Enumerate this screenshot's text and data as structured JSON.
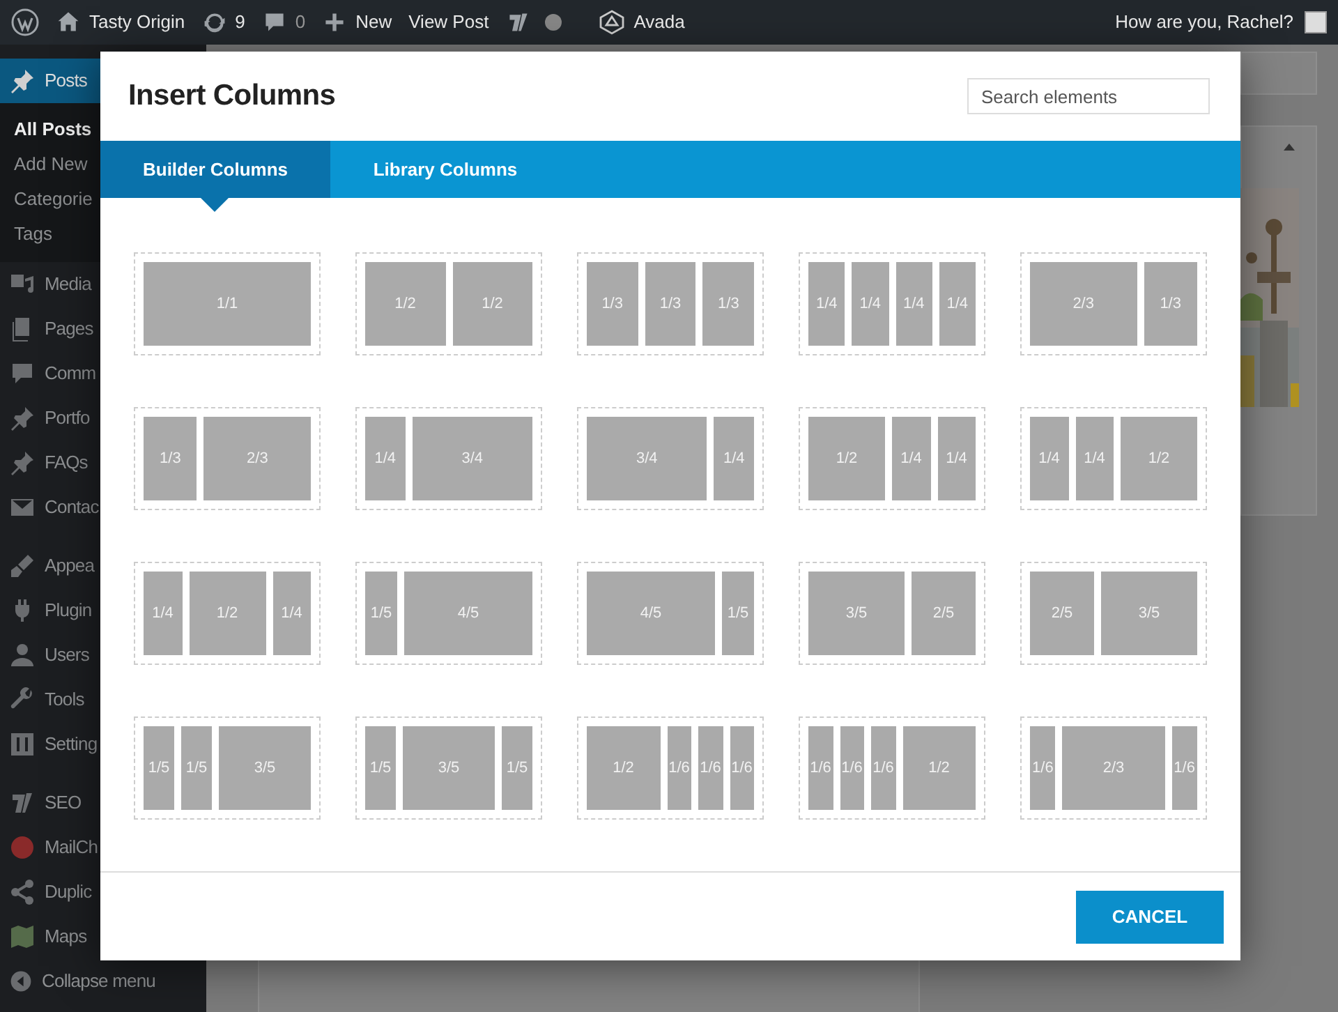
{
  "admin_bar": {
    "site": "Tasty Origin",
    "updates": "9",
    "comments": "0",
    "new": "New",
    "view": "View Post",
    "theme": "Avada",
    "greeting": "How are you, Rachel?"
  },
  "sidebar": {
    "sections": [
      [
        {
          "label": "Posts",
          "selected": true,
          "children": [
            {
              "label": "All Posts",
              "selected": true
            },
            {
              "label": "Add New",
              "selected": false
            },
            {
              "label": "Categorie",
              "selected": false
            },
            {
              "label": "Tags",
              "selected": false
            }
          ]
        },
        {
          "label": "Media",
          "selected": false
        },
        {
          "label": "Pages",
          "selected": false
        },
        {
          "label": "Comm",
          "selected": false
        },
        {
          "label": "Portfo",
          "selected": false
        },
        {
          "label": "FAQs",
          "selected": false
        },
        {
          "label": "Contac",
          "selected": false
        }
      ],
      [
        {
          "label": "Appea",
          "selected": false
        },
        {
          "label": "Plugin",
          "selected": false
        },
        {
          "label": "Users",
          "selected": false
        },
        {
          "label": "Tools",
          "selected": false
        },
        {
          "label": "Setting",
          "selected": false
        }
      ],
      [
        {
          "label": "SEO",
          "selected": false
        },
        {
          "label": "MailCh",
          "selected": false
        },
        {
          "label": "Duplic",
          "selected": false
        },
        {
          "label": "Maps",
          "selected": false
        }
      ]
    ],
    "collapse": "Collapse menu"
  },
  "modal": {
    "title": "Insert Columns",
    "search": {
      "placeholder": "Search elements"
    },
    "tabs": [
      {
        "label": "Builder Columns",
        "selected": true
      },
      {
        "label": "Library Columns",
        "selected": false
      }
    ],
    "layouts": [
      {
        "columns": [
          "1/1"
        ]
      },
      {
        "columns": [
          "1/2",
          "1/2"
        ]
      },
      {
        "columns": [
          "1/3",
          "1/3",
          "1/3"
        ]
      },
      {
        "columns": [
          "1/4",
          "1/4",
          "1/4",
          "1/4"
        ]
      },
      {
        "columns": [
          "2/3",
          "1/3"
        ]
      },
      {
        "columns": [
          "1/3",
          "2/3"
        ]
      },
      {
        "columns": [
          "1/4",
          "3/4"
        ]
      },
      {
        "columns": [
          "3/4",
          "1/4"
        ]
      },
      {
        "columns": [
          "1/2",
          "1/4",
          "1/4"
        ]
      },
      {
        "columns": [
          "1/4",
          "1/4",
          "1/2"
        ]
      },
      {
        "columns": [
          "1/4",
          "1/2",
          "1/4"
        ]
      },
      {
        "columns": [
          "1/5",
          "4/5"
        ]
      },
      {
        "columns": [
          "4/5",
          "1/5"
        ]
      },
      {
        "columns": [
          "3/5",
          "2/5"
        ]
      },
      {
        "columns": [
          "2/5",
          "3/5"
        ]
      },
      {
        "columns": [
          "1/5",
          "1/5",
          "3/5"
        ]
      },
      {
        "columns": [
          "1/5",
          "3/5",
          "1/5"
        ]
      },
      {
        "columns": [
          "1/2",
          "1/6",
          "1/6",
          "1/6"
        ]
      },
      {
        "columns": [
          "1/6",
          "1/6",
          "1/6",
          "1/2"
        ]
      },
      {
        "columns": [
          "1/6",
          "2/3",
          "1/6"
        ]
      }
    ],
    "cancel": "CANCEL"
  }
}
